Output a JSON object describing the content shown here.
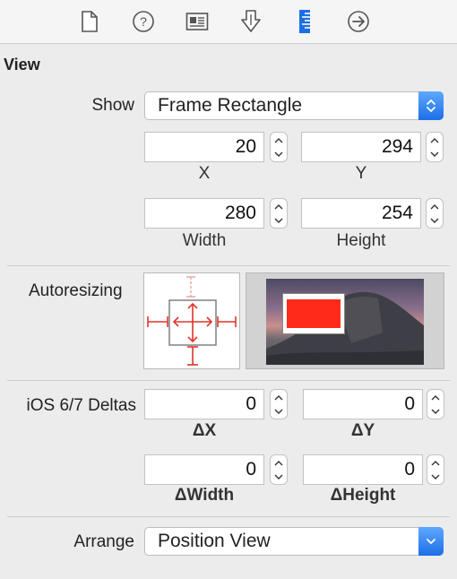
{
  "toolbar": {
    "icons": [
      "file-inspector-icon",
      "quick-help-icon",
      "identity-inspector-icon",
      "attributes-inspector-icon",
      "size-inspector-icon",
      "connections-inspector-icon"
    ],
    "active": "size-inspector-icon",
    "accent": "#1d6fe6"
  },
  "section": {
    "title": "View"
  },
  "show": {
    "label": "Show",
    "value": "Frame Rectangle"
  },
  "frame": {
    "x": {
      "value": "20",
      "caption": "X"
    },
    "y": {
      "value": "294",
      "caption": "Y"
    },
    "width": {
      "value": "280",
      "caption": "Width"
    },
    "height": {
      "value": "254",
      "caption": "Height"
    }
  },
  "autoresizing": {
    "label": "Autoresizing",
    "strut_color": "#e0352b",
    "preview_fill": "#ff2a1a"
  },
  "deltas": {
    "label": "iOS 6/7 Deltas",
    "dx": {
      "value": "0",
      "caption": "ΔX"
    },
    "dy": {
      "value": "0",
      "caption": "ΔY"
    },
    "dwidth": {
      "value": "0",
      "caption": "ΔWidth"
    },
    "dheight": {
      "value": "0",
      "caption": "ΔHeight"
    }
  },
  "arrange": {
    "label": "Arrange",
    "value": "Position View"
  }
}
